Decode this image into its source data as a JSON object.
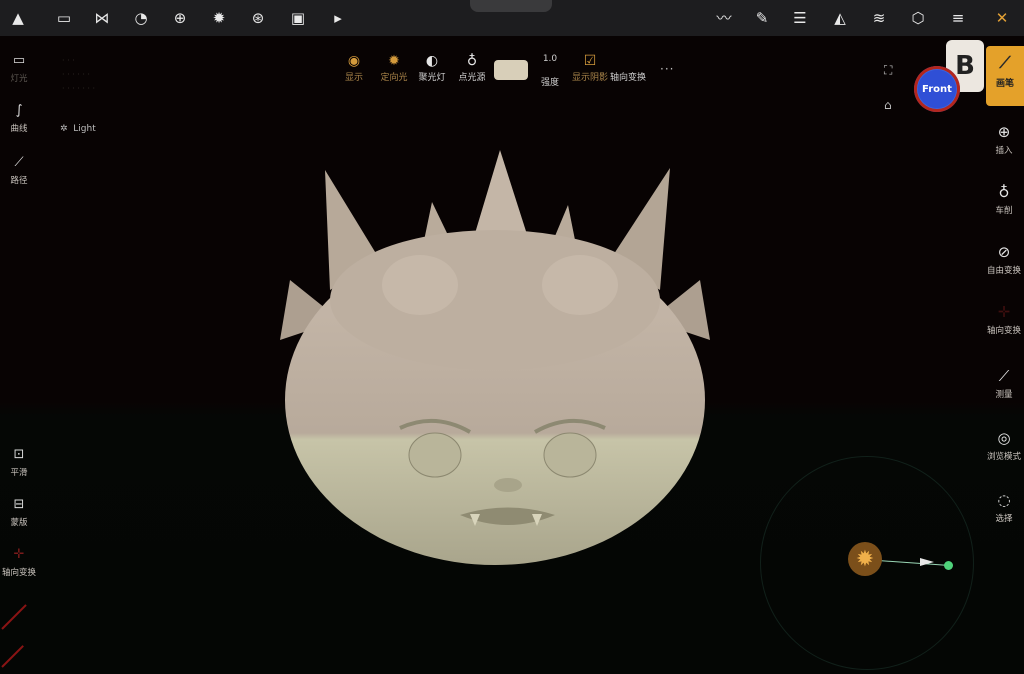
{
  "topbar": {
    "left_icons": [
      "logo-icon",
      "folder-icon",
      "share-icon",
      "primitive-icon",
      "grid-sphere-icon",
      "sun-icon",
      "aperture-icon",
      "image-icon",
      "video-icon"
    ],
    "right_icons": [
      "stroke-icon",
      "brush-icon",
      "menu-icon",
      "symmetry-icon",
      "layers-icon",
      "settings-hex-icon",
      "sliders-icon",
      "tools-icon"
    ]
  },
  "light_toolbar": {
    "items": [
      {
        "label": "显示",
        "icon": "eye-icon"
      },
      {
        "label": "定向光",
        "icon": "sun-small-icon"
      },
      {
        "label": "聚光灯",
        "icon": "spotlight-icon"
      },
      {
        "label": "点光源",
        "icon": "bulb-icon"
      }
    ],
    "intensity_value": "1.0",
    "intensity_label": "强度",
    "shadow_label": "显示阴影",
    "axis_label": "轴向变换",
    "swatch_color": "#d8cfb9"
  },
  "scene": {
    "light_item": "Light"
  },
  "left_tools": {
    "top": [
      {
        "label": "灯光",
        "icon": "camera-icon"
      },
      {
        "label": "曲线",
        "icon": "curve-icon"
      },
      {
        "label": "路径",
        "icon": "path-icon"
      }
    ],
    "bottom": [
      {
        "label": "平滑",
        "icon": "smooth-icon"
      },
      {
        "label": "蒙版",
        "icon": "mask-icon"
      },
      {
        "label": "轴向变换",
        "icon": "gizmo-icon"
      }
    ]
  },
  "right_tools": {
    "active_label": "画笔",
    "items": [
      {
        "label": "插入",
        "icon": "insert-icon"
      },
      {
        "label": "车削",
        "icon": "lathe-icon"
      },
      {
        "label": "自由变换",
        "icon": "free-transform-icon"
      },
      {
        "label": "轴向变换",
        "icon": "axis-gizmo-icon"
      },
      {
        "label": "测量",
        "icon": "ruler-icon"
      },
      {
        "label": "浏览模式",
        "icon": "camera-mode-icon"
      },
      {
        "label": "选择",
        "icon": "select-icon"
      }
    ]
  },
  "viewport": {
    "orientation_label": "Front",
    "badge_text": "B"
  },
  "colors": {
    "accent": "#e4a12a",
    "toolbar_bg": "#1d1d1f",
    "light_dot": "#4fd27b"
  }
}
